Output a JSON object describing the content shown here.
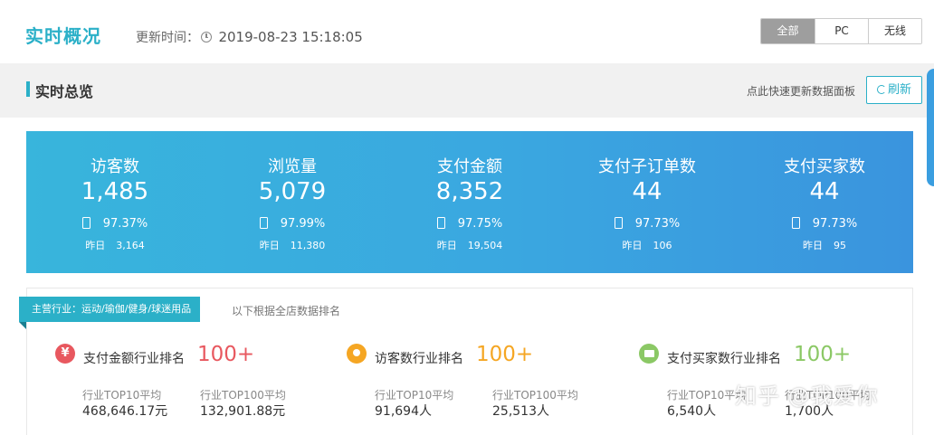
{
  "header": {
    "title": "实时概况",
    "update_label": "更新时间：",
    "update_time": "2019-08-23 15:18:05",
    "segments": [
      "全部",
      "PC",
      "无线"
    ],
    "active_segment": "全部"
  },
  "overview": {
    "title": "实时总览",
    "quick_hint": "点此快速更新数据面板",
    "refresh_label": "刷新"
  },
  "stats": [
    {
      "label": "访客数",
      "value": "1,485",
      "pct": "97.37%",
      "yesterday_label": "昨日",
      "yesterday": "3,164"
    },
    {
      "label": "浏览量",
      "value": "5,079",
      "pct": "97.99%",
      "yesterday_label": "昨日",
      "yesterday": "11,380"
    },
    {
      "label": "支付金额",
      "value": "8,352",
      "pct": "97.75%",
      "yesterday_label": "昨日",
      "yesterday": "19,504"
    },
    {
      "label": "支付子订单数",
      "value": "44",
      "pct": "97.73%",
      "yesterday_label": "昨日",
      "yesterday": "106"
    },
    {
      "label": "支付买家数",
      "value": "44",
      "pct": "97.73%",
      "yesterday_label": "昨日",
      "yesterday": "95"
    }
  ],
  "industry": {
    "tag": "主营行业：运动/瑜伽/健身/球迷用品",
    "note": "以下根据全店数据排名",
    "rankings": [
      {
        "icon": "yen-icon",
        "color": "#e8585f",
        "title": "支付金额行业排名",
        "value": "100+",
        "top10_label": "行业TOP10平均",
        "top10_value": "468,646.17元",
        "top100_label": "行业TOP100平均",
        "top100_value": "132,901.88元"
      },
      {
        "icon": "person-icon",
        "color": "#f5a623",
        "title": "访客数行业排名",
        "value": "100+",
        "top10_label": "行业TOP10平均",
        "top10_value": "91,694人",
        "top100_label": "行业TOP100平均",
        "top100_value": "25,513人"
      },
      {
        "icon": "wallet-icon",
        "color": "#8bc865",
        "title": "支付买家数行业排名",
        "value": "100+",
        "top10_label": "行业TOP10平均",
        "top10_value": "6,540人",
        "top100_label": "行业TOP100平均",
        "top100_value": "1,700人"
      }
    ]
  },
  "watermark": "知乎 @我爱你"
}
